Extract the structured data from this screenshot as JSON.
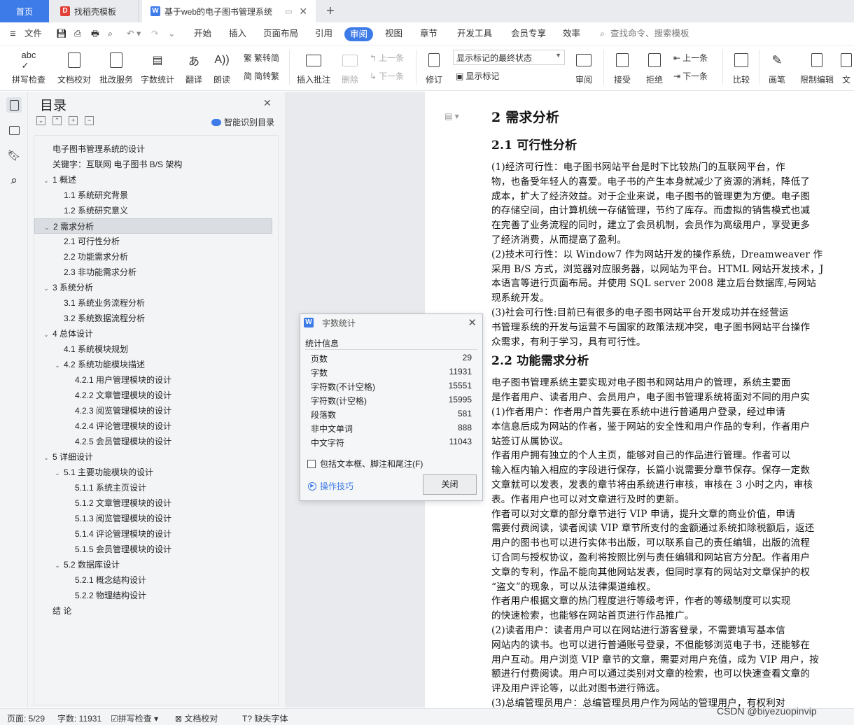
{
  "tabs": {
    "home": "首页",
    "template": "找稻壳模板",
    "doc": "基于web的电子图书管理系统"
  },
  "menu": {
    "file": "文件",
    "items": [
      "开始",
      "插入",
      "页面布局",
      "引用",
      "审阅",
      "视图",
      "章节",
      "开发工具",
      "会员专享",
      "效率"
    ],
    "search": "查找命令、搜索模板"
  },
  "ribbon": {
    "spellcheck": "拼写检查",
    "doccheck": "文档校对",
    "batch": "批改服务",
    "wordcount": "字数统计",
    "translate": "翻译",
    "read": "朗读",
    "to_trad": "繁转简",
    "to_simp": "简转繁",
    "insert_comment": "插入批注",
    "delete": "删除",
    "prev": "上一条",
    "next": "下一条",
    "revise": "修订",
    "markup_select": "显示标记的最终状态",
    "show_markup": "显示标记",
    "review": "审阅",
    "accept": "接受",
    "reject": "拒绝",
    "prev2": "上一条",
    "next2": "下一条",
    "compare": "比较",
    "draw": "画笔",
    "restrict": "限制编辑",
    "doc_trunc": "文"
  },
  "toc": {
    "title": "目录",
    "smart": "智能识别目录",
    "items": [
      {
        "t": "电子图书管理系统的设计",
        "l": 0,
        "c": ""
      },
      {
        "t": "关键字：互联网  电子图书  B/S 架构",
        "l": 0,
        "c": ""
      },
      {
        "t": "1 概述",
        "l": 1,
        "c": "v"
      },
      {
        "t": "1.1 系统研究背景",
        "l": 2,
        "c": ""
      },
      {
        "t": "1.2 系统研究意义",
        "l": 2,
        "c": ""
      },
      {
        "t": "2  需求分析",
        "l": 1,
        "c": "v"
      },
      {
        "t": "2.1 可行性分析",
        "l": 2,
        "c": ""
      },
      {
        "t": "2.2 功能需求分析",
        "l": 2,
        "c": ""
      },
      {
        "t": "2.3 非功能需求分析",
        "l": 2,
        "c": ""
      },
      {
        "t": "3 系统分析",
        "l": 1,
        "c": "v"
      },
      {
        "t": "3.1 系统业务流程分析",
        "l": 2,
        "c": ""
      },
      {
        "t": "3.2 系统数据流程分析",
        "l": 2,
        "c": ""
      },
      {
        "t": "4 总体设计",
        "l": 1,
        "c": "v"
      },
      {
        "t": "4.1 系统模块规划",
        "l": 2,
        "c": ""
      },
      {
        "t": "4.2 系统功能模块描述",
        "l": 2,
        "c": "v"
      },
      {
        "t": "4.2.1 用户管理模块的设计",
        "l": 3,
        "c": ""
      },
      {
        "t": "4.2.2 文章管理模块的设计",
        "l": 3,
        "c": ""
      },
      {
        "t": "4.2.3 阅览管理模块的设计",
        "l": 3,
        "c": ""
      },
      {
        "t": "4.2.4 评论管理模块的设计",
        "l": 3,
        "c": ""
      },
      {
        "t": "4.2.5 会员管理模块的设计",
        "l": 3,
        "c": ""
      },
      {
        "t": "5  详细设计",
        "l": 1,
        "c": "v"
      },
      {
        "t": "5.1 主要功能模块的设计",
        "l": 2,
        "c": "v"
      },
      {
        "t": "5.1.1 系统主页设计",
        "l": 3,
        "c": ""
      },
      {
        "t": "5.1.2 文章管理模块的设计",
        "l": 3,
        "c": ""
      },
      {
        "t": "5.1.3 阅览管理模块的设计",
        "l": 3,
        "c": ""
      },
      {
        "t": "5.1.4 评论管理模块的设计",
        "l": 3,
        "c": ""
      },
      {
        "t": "5.1.5 会员管理模块的设计",
        "l": 3,
        "c": ""
      },
      {
        "t": "5.2 数据库设计",
        "l": 2,
        "c": "v"
      },
      {
        "t": "5.2.1 概念结构设计",
        "l": 3,
        "c": ""
      },
      {
        "t": "5.2.2 物理结构设计",
        "l": 3,
        "c": ""
      },
      {
        "t": "结    论",
        "l": 0,
        "c": ""
      }
    ],
    "selected": 5
  },
  "doc": {
    "lines": [
      {
        "t": "2 需求分析",
        "k": "h1"
      },
      {
        "t": "2.1 可行性分析",
        "k": "h2"
      },
      {
        "t": "    (1)经济可行性：电子图书网站平台是时下比较热门的互联网平台，作",
        "k": "p"
      },
      {
        "t": "物，也备受年轻人的喜爱。电子书的产生本身就减少了资源的消耗，降低了",
        "k": "p"
      },
      {
        "t": "成本，扩大了经济效益。对于企业来说，电子图书的管理更为方便。电子图",
        "k": "p"
      },
      {
        "t": "的存储空间，由计算机统一存储管理，节约了库存。而虚拟的销售模式也减",
        "k": "p"
      },
      {
        "t": "在完善了业务流程的同时，建立了会员机制，会员作为高级用户，享受更多",
        "k": "p"
      },
      {
        "t": "了经济消费，从而提高了盈利。",
        "k": "p"
      },
      {
        "t": "    (2)技术可行性：以 Window7 作为网站开发的操作系统，Dreamweaver 作",
        "k": "p"
      },
      {
        "t": "采用 B/S 方式，浏览器对应服务器，以网站为平台。HTML 网站开发技术，J",
        "k": "p"
      },
      {
        "t": "本语言等进行页面布局。并使用 SQL server 2008 建立后台数据库,与网站",
        "k": "p"
      },
      {
        "t": "现系统开发。",
        "k": "p"
      },
      {
        "t": "    (3)社会可行性:目前已有很多的电子图书网站平台开发成功并在经营运",
        "k": "p"
      },
      {
        "t": "书管理系统的开发与运营不与国家的政策法规冲突，电子图书网站平台操作",
        "k": "p"
      },
      {
        "t": "众需求，有利于学习，具有可行性。",
        "k": "p"
      },
      {
        "t": "2.2 功能需求分析",
        "k": "h2"
      },
      {
        "t": "    电子图书管理系统主要实现对电子图书和网站用户的管理，系统主要面",
        "k": "p"
      },
      {
        "t": "是作者用户、读者用户、会员用户，电子图书管理系统将面对不同的用户实",
        "k": "p"
      },
      {
        "t": "    (1)作者用户：作者用户首先要在系统中进行普通用户登录，经过申请",
        "k": "p"
      },
      {
        "t": "本信息后成为网站的作者，鉴于网站的安全性和用户作品的专利，作者用户",
        "k": "p"
      },
      {
        "t": "站签订从属协议。",
        "k": "p"
      },
      {
        "t": "    作者用户拥有独立的个人主页，能够对自己的作品进行管理。作者可以",
        "k": "p"
      },
      {
        "t": "输入框内输入相应的字段进行保存，长篇小说需要分章节保存。保存一定数",
        "k": "p"
      },
      {
        "t": "文章就可以发表，发表的章节将由系统进行审核，审核在 3 小时之内，审核",
        "k": "p"
      },
      {
        "t": "表。作者用户也可以对文章进行及时的更新。",
        "k": "p"
      },
      {
        "t": "    作者可以对文章的部分章节进行 VIP 申请，提升文章的商业价值，申请",
        "k": "p"
      },
      {
        "t": "需要付费阅读，读者阅读 VIP 章节所支付的金额通过系统扣除税额后，返还",
        "k": "p"
      },
      {
        "t": "用户的图书也可以进行实体书出版，可以联系自己的责任编辑，出版的流程",
        "k": "p"
      },
      {
        "t": "订合同与授权协议，盈利将按照比例与责任编辑和网站官方分配。作者用户",
        "k": "p"
      },
      {
        "t": "文章的专利，作品不能向其他网站发表，但同时享有的网站对文章保护的权",
        "k": "p"
      },
      {
        "t": "“盗文”的现象，可以从法律渠道维权。",
        "k": "p"
      },
      {
        "t": "    作者用户根据文章的热门程度进行等级考评，作者的等级制度可以实现",
        "k": "p"
      },
      {
        "t": "的快速检索，也能够在网站首页进行作品推广。",
        "k": "p"
      },
      {
        "t": "    (2)读者用户：读者用户可以在网站进行游客登录，不需要填写基本信",
        "k": "p"
      },
      {
        "t": "网站内的读书。也可以进行普通账号登录，不但能够浏览电子书，还能够在",
        "k": "p"
      },
      {
        "t": "用户互动。用户浏览 VIP 章节的文章，需要对用户充值，成为 VIP 用户，按",
        "k": "p"
      },
      {
        "t": "额进行付费阅读。用户可以通过类别对文章的检索，也可以快速查看文章的",
        "k": "p"
      },
      {
        "t": "评及用户评论等，以此对图书进行筛选。",
        "k": "p"
      },
      {
        "t": "    (3)总编管理员用户：总编管理员用户作为网站的管理用户，有权利对",
        "k": "p"
      }
    ]
  },
  "dialog": {
    "title": "字数统计",
    "section": "统计信息",
    "rows": [
      {
        "k": "页数",
        "v": "29"
      },
      {
        "k": "字数",
        "v": "11931"
      },
      {
        "k": "字符数(不计空格)",
        "v": "15551"
      },
      {
        "k": "字符数(计空格)",
        "v": "15995"
      },
      {
        "k": "段落数",
        "v": "581"
      },
      {
        "k": "非中文单词",
        "v": "888"
      },
      {
        "k": "中文字符",
        "v": "11043"
      }
    ],
    "checkbox": "包括文本框、脚注和尾注(F)",
    "tips": "操作技巧",
    "close": "关闭"
  },
  "status": {
    "page": "页面: 5/29",
    "words": "字数: 11931",
    "spell": "拼写检查",
    "doccheck": "文档校对",
    "missing_font": "缺失字体"
  },
  "watermark": "CSDN @biyezuopinvip"
}
